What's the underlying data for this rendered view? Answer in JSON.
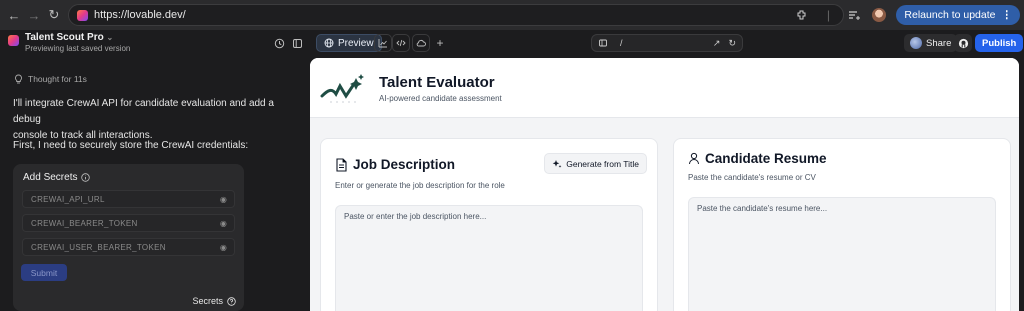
{
  "browser": {
    "url": "https://lovable.dev/",
    "relaunch_label": "Relaunch to update"
  },
  "appbar": {
    "project_name": "Talent Scout Pro",
    "project_status": "Previewing last saved version",
    "preview_label": "Preview",
    "route": "/",
    "share_label": "Share",
    "publish_label": "Publish"
  },
  "chat": {
    "thought": "Thought for 11s",
    "message1_line1": "I'll integrate CrewAI API for candidate evaluation and add a debug",
    "message1_line2": "console to track all interactions.",
    "message2": "First, I need to securely store the CrewAI credentials:",
    "secrets": {
      "title": "Add Secrets",
      "fields": [
        "CREWAI_API_URL",
        "CREWAI_BEARER_TOKEN",
        "CREWAI_USER_BEARER_TOKEN"
      ],
      "submit_label": "Submit",
      "footer_label": "Secrets"
    }
  },
  "app": {
    "title": "Talent Evaluator",
    "subtitle": "AI-powered candidate assessment",
    "job": {
      "title": "Job Description",
      "description": "Enter or generate the job description for the role",
      "generate_label": "Generate from Title",
      "placeholder": "Paste or enter the job description here..."
    },
    "resume": {
      "title": "Candidate Resume",
      "description": "Paste the candidate's resume or CV",
      "placeholder": "Paste the candidate's resume here..."
    }
  }
}
